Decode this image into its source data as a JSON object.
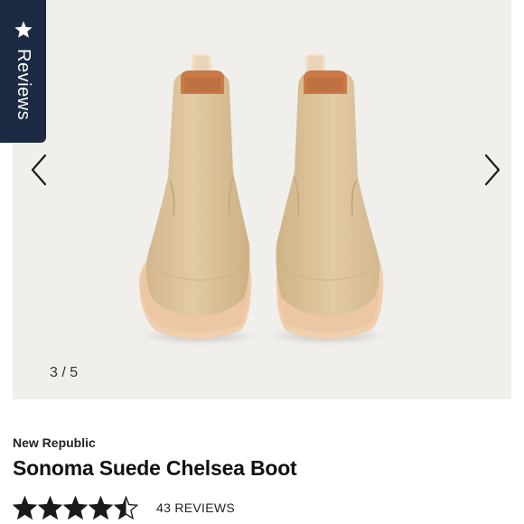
{
  "reviews_tab": {
    "label": "Reviews",
    "icon": "star-icon"
  },
  "gallery": {
    "counter": "3 / 5",
    "prev_icon": "chevron-left-icon",
    "next_icon": "chevron-right-icon",
    "background": "#f1efec"
  },
  "product": {
    "brand": "New Republic",
    "title": "Sonoma Suede Chelsea Boot",
    "rating": 4.5,
    "rating_max": 5,
    "reviews_label": "43 REVIEWS"
  },
  "colors": {
    "tab_bg": "#1d2a44",
    "text": "#111111",
    "star": "#1a1a1a",
    "suede": "#dcc29b",
    "sole": "#f0cfae"
  }
}
